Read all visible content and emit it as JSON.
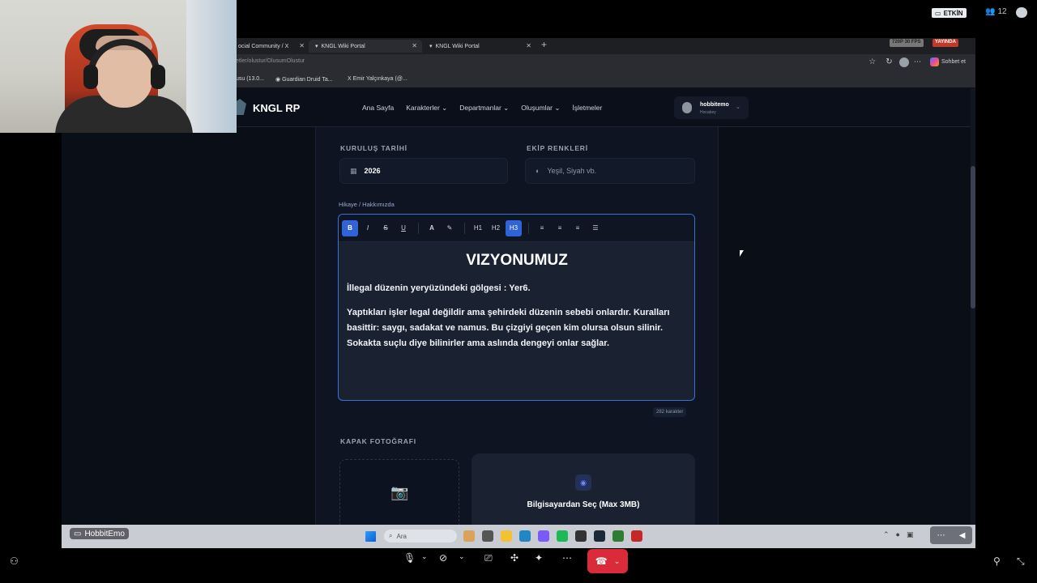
{
  "discord": {
    "live_label": "ETKİN",
    "viewer_count": "12",
    "streamer_name": "HobbitEmo"
  },
  "browser": {
    "tabs": [
      {
        "title": "ocial Community / X"
      },
      {
        "title": "KNGL Wiki Portal"
      },
      {
        "title": "KNGL Wiki Portal"
      }
    ],
    "url": "etler/olustur/OlusumOlustur",
    "stream_quality": "720P 30 FPS",
    "live_badge": "YAYINDA",
    "chat_label": "Sohbet et",
    "bookmarks": [
      "usu (13.0...",
      "Guardian Druid Ta...",
      "Emir Yalçınkaya (@..."
    ]
  },
  "site": {
    "logo": "KNGL RP",
    "nav": [
      "Ana Sayfa",
      "Karakterler",
      "Departmanlar",
      "Oluşumlar",
      "İşletmeler"
    ],
    "user_name": "hobbitemo",
    "user_role": "Hocabey"
  },
  "form": {
    "founding_label": "KURULUŞ TARİHİ",
    "founding_value": "2026",
    "colors_label": "EKİP RENKLERİ",
    "colors_placeholder": "Yeşil, Siyah vb.",
    "story_label": "Hikaye / Hakkımızda",
    "editor_heading": "VIZYONUMUZ",
    "editor_line1": "İllegal düzenin yeryüzündeki gölgesi : Yer6.",
    "editor_line2": " Yaptıkları işler legal değildir ama şehirdeki düzenin sebebi onlardır. Kuralları basittir: saygı, sadakat ve namus. Bu çizgiyi geçen kim olursa olsun silinir. Sokakta suçlu diye bilinirler ama aslında dengeyi onlar sağlar.",
    "char_count": "282 karakter",
    "cover_label": "KAPAK FOTOĞRAFI",
    "upload_label": "Bilgisayardan Seç (Max 3MB)"
  },
  "toolbar": [
    "B",
    "I",
    "S",
    "U",
    "A",
    "H1",
    "H2",
    "H3"
  ],
  "taskbar": {
    "search_placeholder": "Ara"
  }
}
